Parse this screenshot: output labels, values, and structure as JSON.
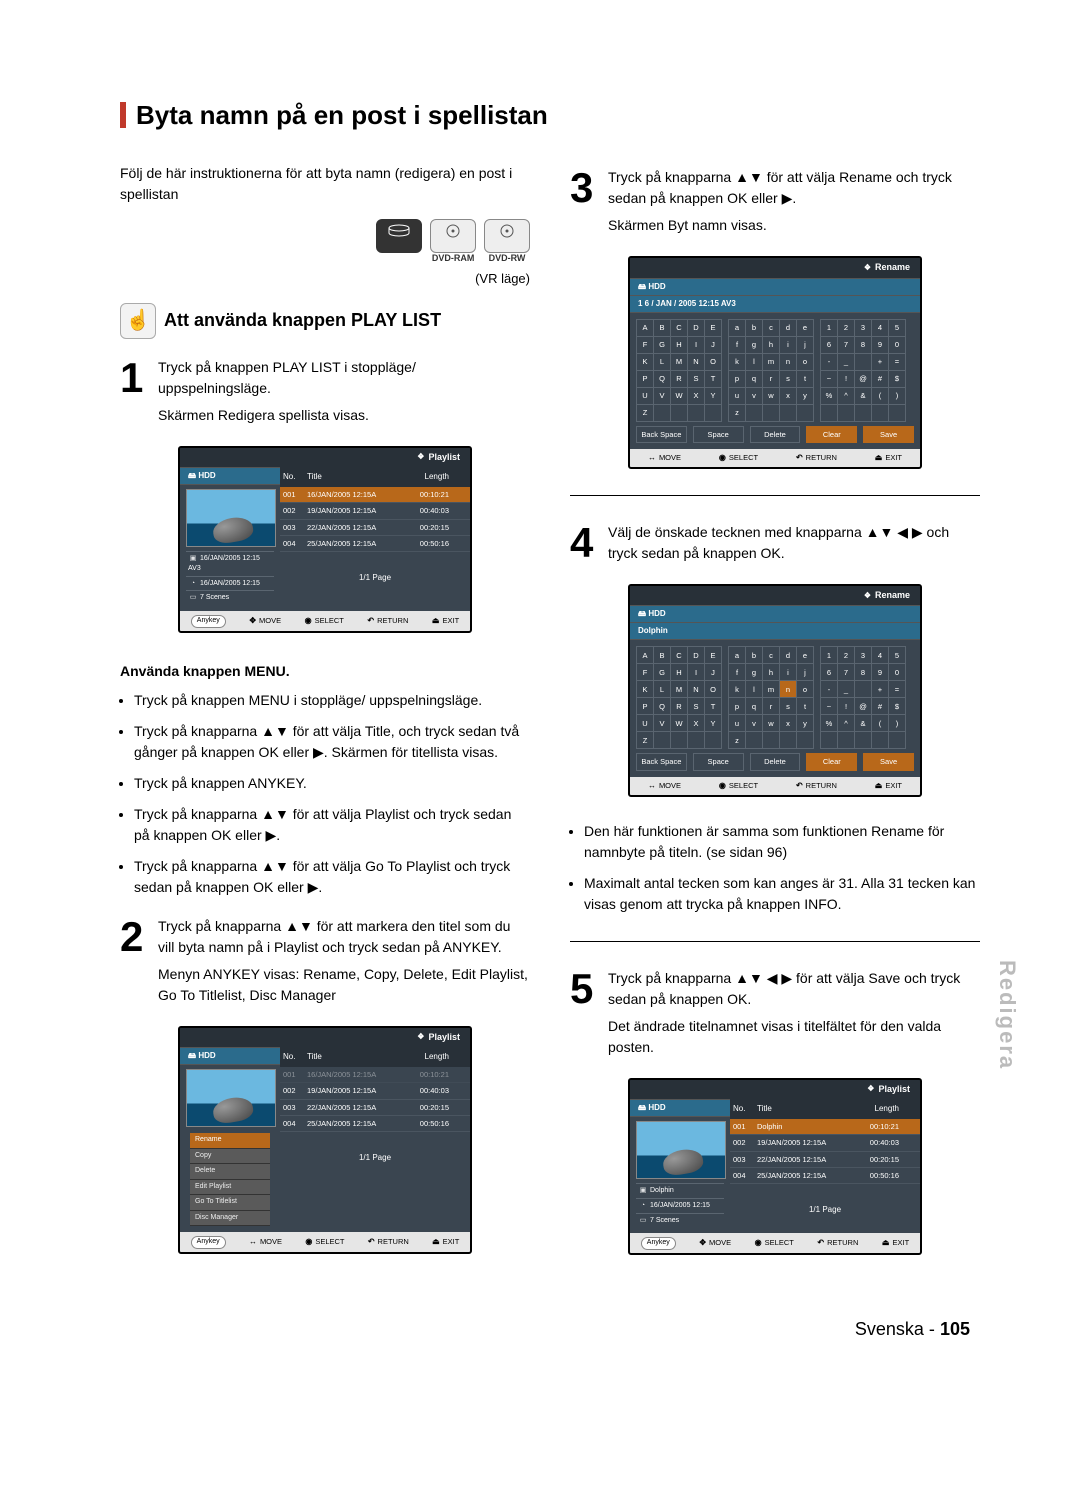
{
  "heading": "Byta namn på en post i spellistan",
  "intro": "Följ de här instruktionerna för att byta namn (redigera) en post i spellistan",
  "media": {
    "hdd": "HDD",
    "dvdram": "DVD-RAM",
    "dvdrw": "DVD-RW"
  },
  "vr_label": "(VR läge)",
  "subheading": "Att använda knappen PLAY LIST",
  "step1": {
    "num": "1",
    "line1": "Tryck på knappen PLAY LIST i stoppläge/ uppspelningsläge.",
    "line2": "Skärmen Redigera spellista visas."
  },
  "ss_playlist": {
    "top": "Playlist",
    "hdd": "HDD",
    "cols": {
      "no": "No.",
      "title": "Title",
      "len": "Length"
    },
    "rows": [
      {
        "no": "001",
        "title": "16/JAN/2005 12:15A",
        "len": "00:10:21",
        "sel": true
      },
      {
        "no": "002",
        "title": "19/JAN/2005 12:15A",
        "len": "00:40:03"
      },
      {
        "no": "003",
        "title": "22/JAN/2005 12:15A",
        "len": "00:20:15"
      },
      {
        "no": "004",
        "title": "25/JAN/2005 12:15A",
        "len": "00:50:16"
      }
    ],
    "info1": "16/JAN/2005 12:15 AV3",
    "info2": "16/JAN/2005 12:15",
    "info3": "7 Scenes",
    "page": "1/1 Page"
  },
  "ss_foot": {
    "anykey": "Anykey",
    "move": "MOVE",
    "select": "SELECT",
    "ret": "RETURN",
    "exit": "EXIT"
  },
  "menu_heading": "Använda knappen MENU.",
  "menu_bullets": [
    "Tryck på knappen MENU i stoppläge/ uppspelningsläge.",
    "Tryck på knapparna ▲▼ för att välja Title, och tryck sedan två gånger på knappen OK eller ▶. Skärmen för titellista visas.",
    "Tryck på knappen ANYKEY.",
    "Tryck på knapparna ▲▼ för att välja Playlist och tryck sedan på knappen OK eller ▶.",
    "Tryck på knapparna ▲▼ för att välja Go To Playlist och tryck sedan på knappen OK eller ▶."
  ],
  "step2": {
    "num": "2",
    "line1": "Tryck på knapparna ▲▼ för att markera den titel som du vill byta namn på i Playlist och tryck sedan på ANYKEY.",
    "line2": "Menyn ANYKEY visas: Rename, Copy, Delete, Edit Playlist, Go To Titlelist, Disc Manager"
  },
  "anykey_menu": [
    "Rename",
    "Copy",
    "Delete",
    "Edit Playlist",
    "Go To Titlelist",
    "Disc Manager"
  ],
  "step3": {
    "num": "3",
    "line1": "Tryck på knapparna ▲▼ för att välja Rename och tryck sedan på knappen OK eller ▶.",
    "line2": "Skärmen Byt namn visas."
  },
  "ss_rename": {
    "top": "Rename",
    "hdd": "HDD",
    "entry1": "1 6 / JAN / 2005 12:15 AV3",
    "entry2": "Dolphin",
    "upper": [
      [
        "A",
        "B",
        "C",
        "D",
        "E"
      ],
      [
        "F",
        "G",
        "H",
        "I",
        "J"
      ],
      [
        "K",
        "L",
        "M",
        "N",
        "O"
      ],
      [
        "P",
        "Q",
        "R",
        "S",
        "T"
      ],
      [
        "U",
        "V",
        "W",
        "X",
        "Y"
      ],
      [
        "Z",
        "",
        "",
        "",
        ""
      ]
    ],
    "lower": [
      [
        "a",
        "b",
        "c",
        "d",
        "e"
      ],
      [
        "f",
        "g",
        "h",
        "i",
        "j"
      ],
      [
        "k",
        "l",
        "m",
        "n",
        "o"
      ],
      [
        "p",
        "q",
        "r",
        "s",
        "t"
      ],
      [
        "u",
        "v",
        "w",
        "x",
        "y"
      ],
      [
        "z",
        "",
        "",
        "",
        ""
      ]
    ],
    "nums": [
      [
        "1",
        "2",
        "3",
        "4",
        "5"
      ],
      [
        "6",
        "7",
        "8",
        "9",
        "0"
      ],
      [
        "-",
        "_",
        " ",
        "+",
        "="
      ],
      [
        "~",
        "!",
        "@",
        "#",
        "$"
      ],
      [
        "%",
        "^",
        "&",
        "(",
        ")"
      ],
      [
        "",
        "",
        "",
        "",
        ""
      ]
    ],
    "btn_back": "Back Space",
    "btn_space": "Space",
    "btn_delete": "Delete",
    "btn_clear": "Clear",
    "btn_save": "Save"
  },
  "ss_foot_kb": {
    "move": "MOVE",
    "sel": "SELECT",
    "ret": "RETURN",
    "exit": "EXIT"
  },
  "step4": {
    "num": "4",
    "line1": "Välj de önskade tecknen med knapparna ▲▼ ◀ ▶ och tryck sedan på knappen OK."
  },
  "after4_bullets": [
    "Den här funktionen är samma som funktionen Rename för namnbyte på titeln. (se sidan 96)",
    "Maximalt antal tecken som kan anges är 31. Alla 31 tecken kan visas genom att trycka på knappen INFO."
  ],
  "step5": {
    "num": "5",
    "line1": "Tryck på knapparna ▲▼ ◀ ▶ för att välja Save och tryck sedan på knappen OK.",
    "line2": "Det ändrade titelnamnet visas i titelfältet för den valda posten."
  },
  "ss_playlist2": {
    "top": "Playlist",
    "hdd": "HDD",
    "cols": {
      "no": "No.",
      "title": "Title",
      "len": "Length"
    },
    "rows": [
      {
        "no": "001",
        "title": "Dolphin",
        "len": "00:10:21",
        "sel": true
      },
      {
        "no": "002",
        "title": "19/JAN/2005 12:15A",
        "len": "00:40:03"
      },
      {
        "no": "003",
        "title": "22/JAN/2005 12:15A",
        "len": "00:20:15"
      },
      {
        "no": "004",
        "title": "25/JAN/2005 12:15A",
        "len": "00:50:16"
      }
    ],
    "info1": "Dolphin",
    "info2": "16/JAN/2005 12:15",
    "info3": "7 Scenes",
    "page": "1/1 Page"
  },
  "side_tab": "Redigera",
  "footer_lang": "Svenska -",
  "footer_page": "105"
}
